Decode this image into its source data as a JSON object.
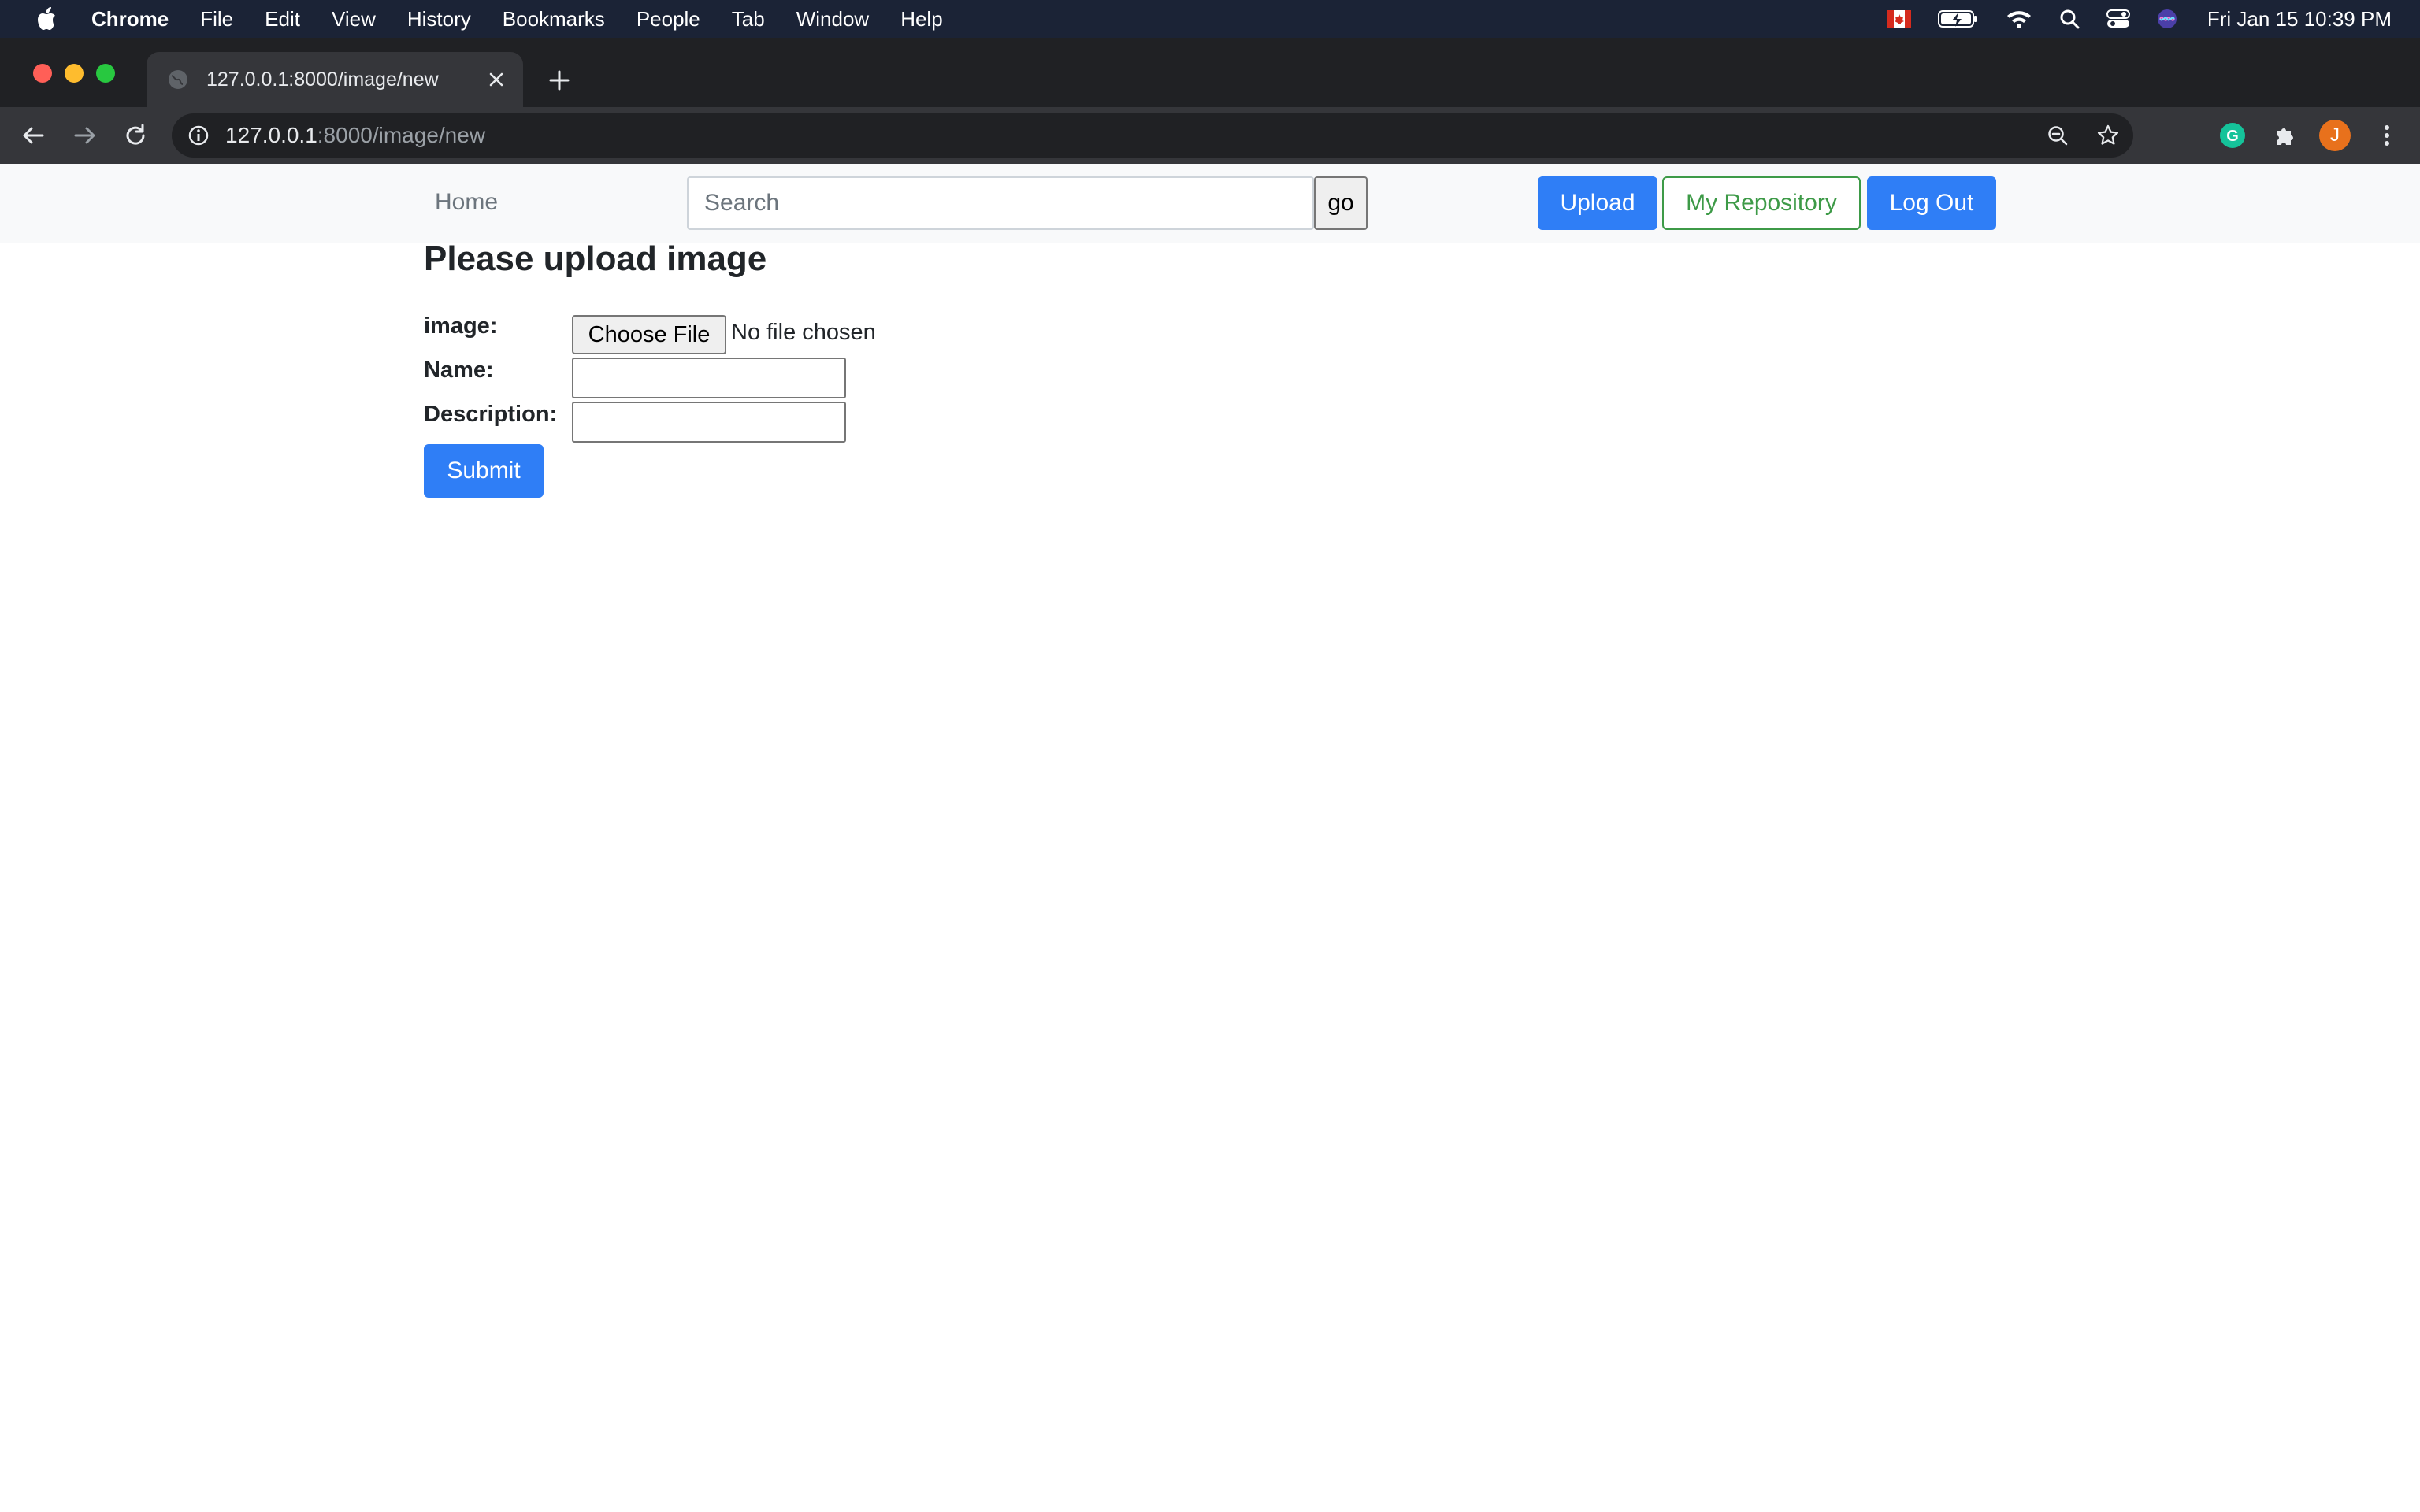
{
  "menubar": {
    "app_name": "Chrome",
    "items": [
      "File",
      "Edit",
      "View",
      "History",
      "Bookmarks",
      "People",
      "Tab",
      "Window",
      "Help"
    ],
    "clock": "Fri Jan 15  10:39 PM",
    "status_icons": [
      "canada-flag-icon",
      "battery-charging-icon",
      "wifi-icon",
      "spotlight-search-icon",
      "control-center-icon",
      "siri-icon"
    ]
  },
  "browser": {
    "tab_title": "127.0.0.1:8000/image/new",
    "url_host": "127.0.0.1",
    "url_path": ":8000/image/new",
    "profile_initial": "J",
    "extension_initial": "G"
  },
  "nav": {
    "home_label": "Home",
    "search_placeholder": "Search",
    "go_label": "go",
    "upload_label": "Upload",
    "repository_label": "My Repository",
    "logout_label": "Log Out"
  },
  "form": {
    "heading": "Please upload image",
    "image_label": "image:",
    "choose_file_label": "Choose File",
    "file_status": "No file chosen",
    "name_label": "Name:",
    "name_value": "",
    "description_label": "Description:",
    "description_value": "",
    "submit_label": "Submit"
  },
  "colors": {
    "primary": "#2f7ef6",
    "success": "#3d9a47",
    "menubar": "#1b2336",
    "nav_background": "#f8f9fa"
  }
}
